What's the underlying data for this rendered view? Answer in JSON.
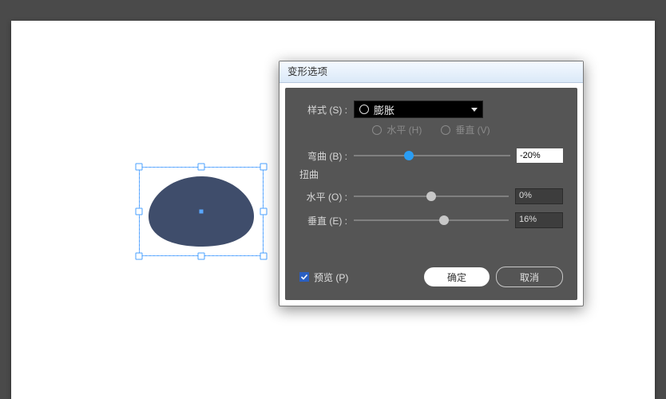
{
  "dialog": {
    "title": "变形选项",
    "style": {
      "label": "样式 (S) :",
      "selected": "膨胀"
    },
    "orientation": {
      "horizontal": {
        "label": "水平 (H)",
        "selected": true
      },
      "vertical": {
        "label": "垂直 (V)",
        "selected": false
      }
    },
    "bend": {
      "label": "弯曲 (B) :",
      "value": "-20%",
      "pos": 35
    },
    "distort_section": "扭曲",
    "horiz": {
      "label": "水平 (O) :",
      "value": "0%",
      "pos": 50
    },
    "vert": {
      "label": "垂直 (E) :",
      "value": "16%",
      "pos": 58
    },
    "preview": {
      "label": "预览 (P)",
      "checked": true
    },
    "ok": "确定",
    "cancel": "取消"
  }
}
